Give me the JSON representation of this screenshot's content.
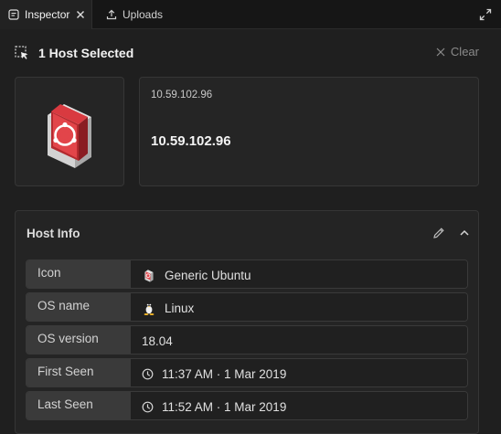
{
  "tabs": {
    "inspector": {
      "label": "Inspector"
    },
    "uploads": {
      "label": "Uploads"
    }
  },
  "selection": {
    "title": "1 Host Selected",
    "clear_label": "Clear"
  },
  "host": {
    "subtitle": "10.59.102.96",
    "title": "10.59.102.96"
  },
  "host_info": {
    "title": "Host Info",
    "rows": [
      {
        "label": "Icon",
        "value": "Generic Ubuntu",
        "icon": "ubuntu-host-icon"
      },
      {
        "label": "OS name",
        "value": "Linux",
        "icon": "linux-tux-icon"
      },
      {
        "label": "OS version",
        "value": "18.04",
        "icon": ""
      },
      {
        "label": "First Seen",
        "value": "11:37 AM · 1 Mar 2019",
        "icon": "clock-icon"
      },
      {
        "label": "Last Seen",
        "value": "11:52 AM · 1 Mar 2019",
        "icon": "clock-icon"
      }
    ]
  },
  "colors": {
    "ubuntu_red": "#e2454a",
    "background": "#1f1f1f",
    "label_bg": "#3a3a3a"
  }
}
